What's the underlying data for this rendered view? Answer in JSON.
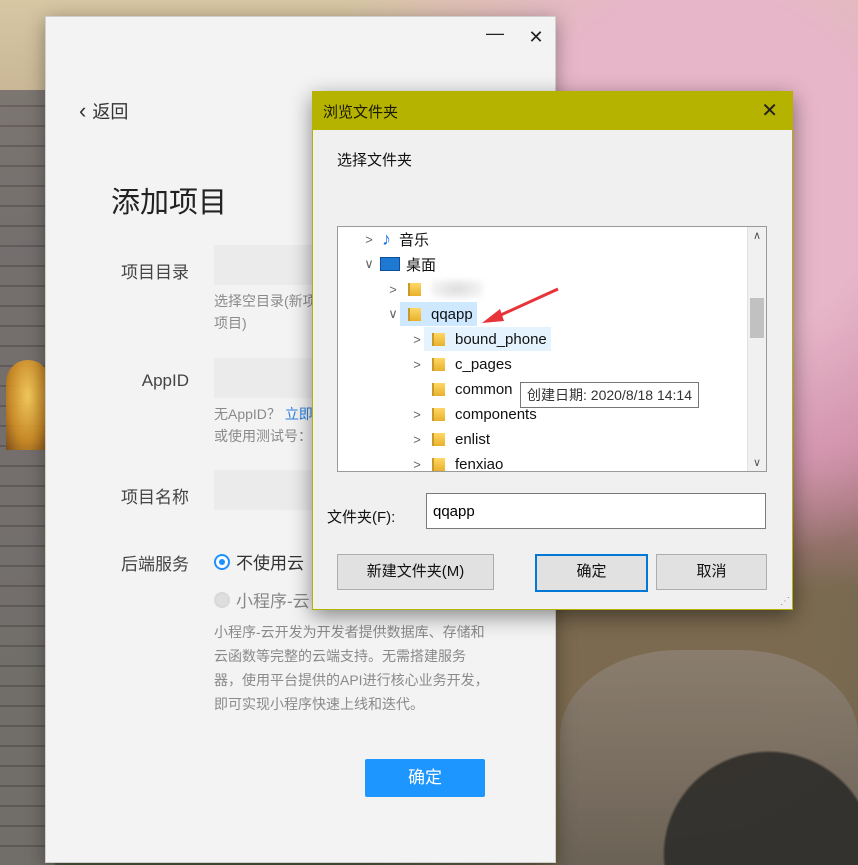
{
  "app": {
    "back_label": "返回",
    "page_title": "添加项目",
    "project_dir": {
      "label": "项目目录",
      "hint": "选择空目录(新项\n项目)"
    },
    "appid": {
      "label": "AppID",
      "hint_line1": "无AppID？",
      "hint_link": "立即",
      "hint_line2": "或使用测试号："
    },
    "project_name": {
      "label": "项目名称"
    },
    "backend": {
      "label": "后端服务",
      "option1": "不使用云",
      "option2": "小程序-云",
      "description": "小程序-云开发为开发者提供数据库、存储和云函数等完整的云端支持。无需搭建服务器，使用平台提供的API进行核心业务开发，即可实现小程序快速上线和迭代。"
    },
    "confirm_label": "确定"
  },
  "dialog": {
    "title": "浏览文件夹",
    "subtitle": "选择文件夹",
    "tree": [
      {
        "label": "音乐",
        "icon": "music-icon",
        "expander": "collapsed",
        "level": 0
      },
      {
        "label": "桌面",
        "icon": "desktop-icon",
        "expander": "expanded",
        "level": 0
      },
      {
        "label": "",
        "icon": "folder-icon",
        "expander": "collapsed",
        "level": 1,
        "blurred": true
      },
      {
        "label": "qqapp",
        "icon": "folder-icon",
        "expander": "expanded",
        "level": 1,
        "state": "selected"
      },
      {
        "label": "bound_phone",
        "icon": "folder-icon",
        "expander": "collapsed",
        "level": 2,
        "state": "hover"
      },
      {
        "label": "c_pages",
        "icon": "folder-icon",
        "expander": "collapsed",
        "level": 2
      },
      {
        "label": "common",
        "icon": "folder-icon",
        "expander": "none",
        "level": 2
      },
      {
        "label": "components",
        "icon": "folder-icon",
        "expander": "collapsed",
        "level": 2
      },
      {
        "label": "enlist",
        "icon": "folder-icon",
        "expander": "collapsed",
        "level": 2
      },
      {
        "label": "fenxiao",
        "icon": "folder-icon",
        "expander": "collapsed",
        "level": 2
      }
    ],
    "tooltip": "创建日期: 2020/8/18 14:14",
    "folder_label": "文件夹(F):",
    "folder_value": "qqapp",
    "new_folder_label": "新建文件夹(M)",
    "ok_label": "确定",
    "cancel_label": "取消"
  },
  "colors": {
    "dialog_titlebar": "#b5b200",
    "primary_button": "#1e96ff",
    "selection": "#cde8ff",
    "annotation_arrow": "#e8333a"
  }
}
